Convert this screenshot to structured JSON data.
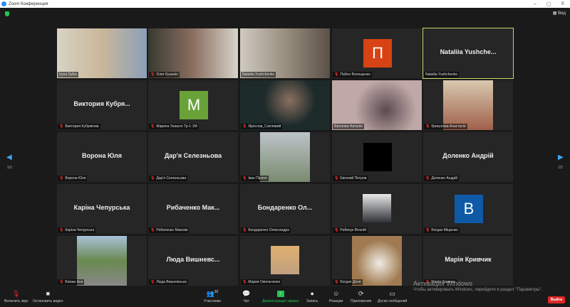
{
  "window": {
    "title": "Zoom Конференция",
    "minimize": "–",
    "restore": "▢",
    "close": "X"
  },
  "header": {
    "view_label": "▦ Вид"
  },
  "pager": {
    "left": "1/2",
    "right": "1/2"
  },
  "tiles": [
    {
      "name": "Iryna Sylka",
      "type": "video",
      "bg": "linear-gradient(90deg,#d9d2c4,#c9b79a,#8ca0b8)"
    },
    {
      "name": "Олег Кузьмін",
      "type": "video",
      "muted": true,
      "bg": "linear-gradient(90deg,#3a3a30,#8a6f60,#d8d4cc)"
    },
    {
      "name": "Nataliia Yushchenko",
      "type": "video",
      "bg": "linear-gradient(90deg,#cfcac0,#9a8f80,#5a5048)"
    },
    {
      "name": "Пабло Волощенко",
      "type": "avatar",
      "muted": true,
      "letter": "П",
      "color": "#d84315"
    },
    {
      "name": "Nataliia Yushchenko",
      "type": "text",
      "big": "Nataliia  Yushche...",
      "active": true
    },
    {
      "name": "Виктория Кубрякова",
      "type": "text",
      "muted": true,
      "big": "Виктория  Кубря..."
    },
    {
      "name": "Марина Ушкало Тр-1-1М",
      "type": "avatar",
      "muted": true,
      "letter": "M",
      "color": "#6aa23a"
    },
    {
      "name": "Ярослав_Сапливий",
      "type": "video",
      "muted": true,
      "bg": "radial-gradient(circle at 55% 40%,#8a7060,#1d2a2a 45%)"
    },
    {
      "name": "Фролова Наталія",
      "type": "video",
      "bg": "radial-gradient(circle at 60% 60%,#5a4a50,#bfa8a6 50%)"
    },
    {
      "name": "Крикунова Анастасія",
      "type": "thumb",
      "muted": true,
      "bg": "linear-gradient(#d9c9b0,#a0604a)",
      "w": 70
    },
    {
      "name": "Ворона Юля",
      "type": "text",
      "muted": true,
      "big": "Ворона  Юля"
    },
    {
      "name": "Дар'я Селезньова",
      "type": "text",
      "muted": true,
      "big": "Дар'я  Селезньова"
    },
    {
      "name": "Іван Пірхоя",
      "type": "thumb",
      "muted": true,
      "bg": "linear-gradient(#bcc4c8,#7a8a70)",
      "w": 70
    },
    {
      "name": "Евгений Петров",
      "type": "avatar",
      "muted": true,
      "letter": "",
      "color": "#000"
    },
    {
      "name": "Доленко Андрій",
      "type": "text",
      "muted": true,
      "big": "Доленко  Андрій"
    },
    {
      "name": "Каріна Чепурська",
      "type": "text",
      "muted": true,
      "big": "Каріна  Чепурська"
    },
    {
      "name": "Рибаченко Максим",
      "type": "text",
      "muted": true,
      "big": "Рибаченко  Мак..."
    },
    {
      "name": "Бондаренко Олександра",
      "type": "text",
      "muted": true,
      "big": "Бондаренко  Ол..."
    },
    {
      "name": "Рибачук Віталій",
      "type": "thumb",
      "muted": true,
      "bg": "linear-gradient(#e8e8e8,#303438)",
      "w": 40
    },
    {
      "name": "Богдан Міщенко",
      "type": "avatar",
      "muted": true,
      "letter": "B",
      "color": "#0e5aa7"
    },
    {
      "name": "Божан Аня",
      "type": "thumb",
      "muted": true,
      "bg": "linear-gradient(#a8c0d8,#6a8a50,#888)",
      "w": 70
    },
    {
      "name": "Люда Вишневська",
      "type": "text",
      "muted": true,
      "big": "Люда  Вишневс..."
    },
    {
      "name": "Мария Омельченко",
      "type": "thumb",
      "muted": true,
      "bg": "linear-gradient(#e0b070,#c0a080)",
      "w": 40
    },
    {
      "name": "Богдан Доня",
      "type": "thumb",
      "muted": true,
      "bg": "radial-gradient(circle at 55% 55%,#f0ece4,#a07a50 60%)",
      "w": 70
    },
    {
      "name": "Марія Кривчик",
      "type": "text",
      "muted": true,
      "big": "Марія  Кривчик"
    }
  ],
  "toolbar": {
    "mute": "Включить звук",
    "video": "Остановить видео",
    "participants": "Участники",
    "participants_count": "30",
    "chat": "Чат",
    "share": "Демонстрация экрана",
    "record": "Запись",
    "reactions": "Реакции",
    "apps": "Приложения",
    "whiteboard": "Доски сообщений",
    "leave": "Выйти"
  },
  "watermark": {
    "title": "Активация Windows",
    "text": "Чтобы активировать Windows, перейдите в раздел \"Параметры\"."
  }
}
